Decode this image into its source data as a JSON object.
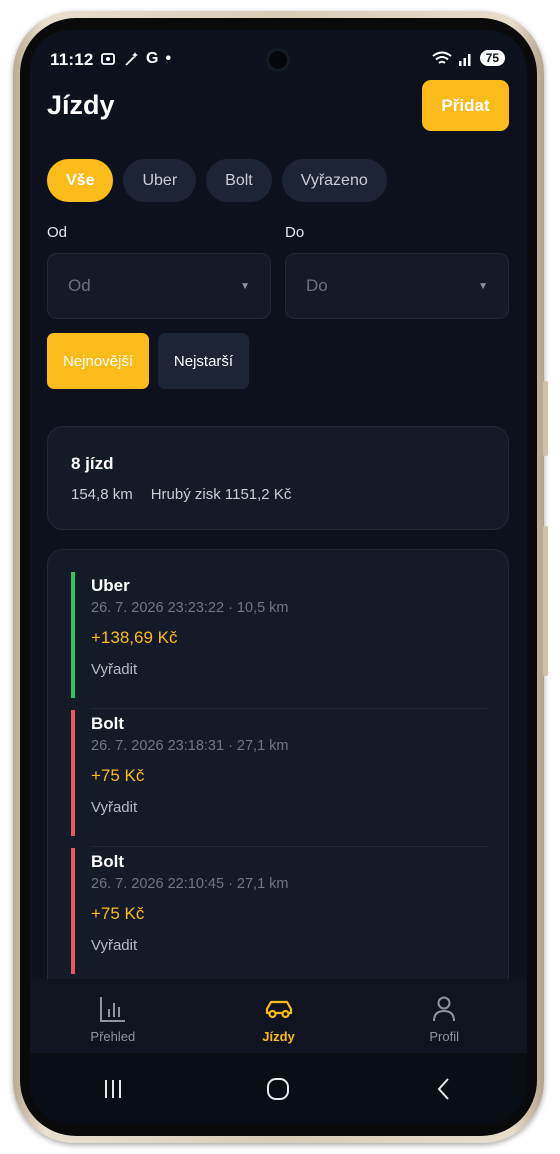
{
  "status_bar": {
    "time": "11:12",
    "left_icons": [
      "screenshot-icon",
      "magic-wand-icon",
      "G",
      "•"
    ],
    "battery": "75"
  },
  "header": {
    "title": "Jízdy",
    "add_label": "Přidat"
  },
  "filters": {
    "chips": [
      {
        "label": "Vše",
        "active": true
      },
      {
        "label": "Uber",
        "active": false
      },
      {
        "label": "Bolt",
        "active": false
      },
      {
        "label": "Vyřazeno",
        "active": false
      }
    ]
  },
  "date_range": {
    "from_label": "Od",
    "from_placeholder": "Od",
    "to_label": "Do",
    "to_placeholder": "Do"
  },
  "sort": {
    "newest": "Nejnovější",
    "oldest": "Nejstarší",
    "active": "newest"
  },
  "summary": {
    "count": "8 jízd",
    "distance": "154,8 km",
    "gross": "Hrubý zisk 1151,2 Kč"
  },
  "rides": [
    {
      "source": "Uber",
      "meta": "26. 7. 2026 23:23:22 · 10,5 km",
      "amount": "+138,69 Kč",
      "action": "Vyřadit",
      "accent": "#2fc65d"
    },
    {
      "source": "Bolt",
      "meta": "26. 7. 2026 23:18:31 · 27,1 km",
      "amount": "+75 Kč",
      "action": "Vyřadit",
      "accent": "#e8595c"
    },
    {
      "source": "Bolt",
      "meta": "26. 7. 2026 22:10:45 · 27,1 km",
      "amount": "+75 Kč",
      "action": "Vyřadit",
      "accent": "#e8595c"
    }
  ],
  "bottom_nav": [
    {
      "label": "Přehled",
      "icon": "chart-icon",
      "active": false
    },
    {
      "label": "Jízdy",
      "icon": "car-icon",
      "active": true
    },
    {
      "label": "Profil",
      "icon": "profile-icon",
      "active": false
    }
  ],
  "colors": {
    "accent": "#fbbb1a",
    "background": "#0c111d",
    "card": "#141a28",
    "uber": "#2fc65d",
    "bolt": "#e8595c"
  }
}
